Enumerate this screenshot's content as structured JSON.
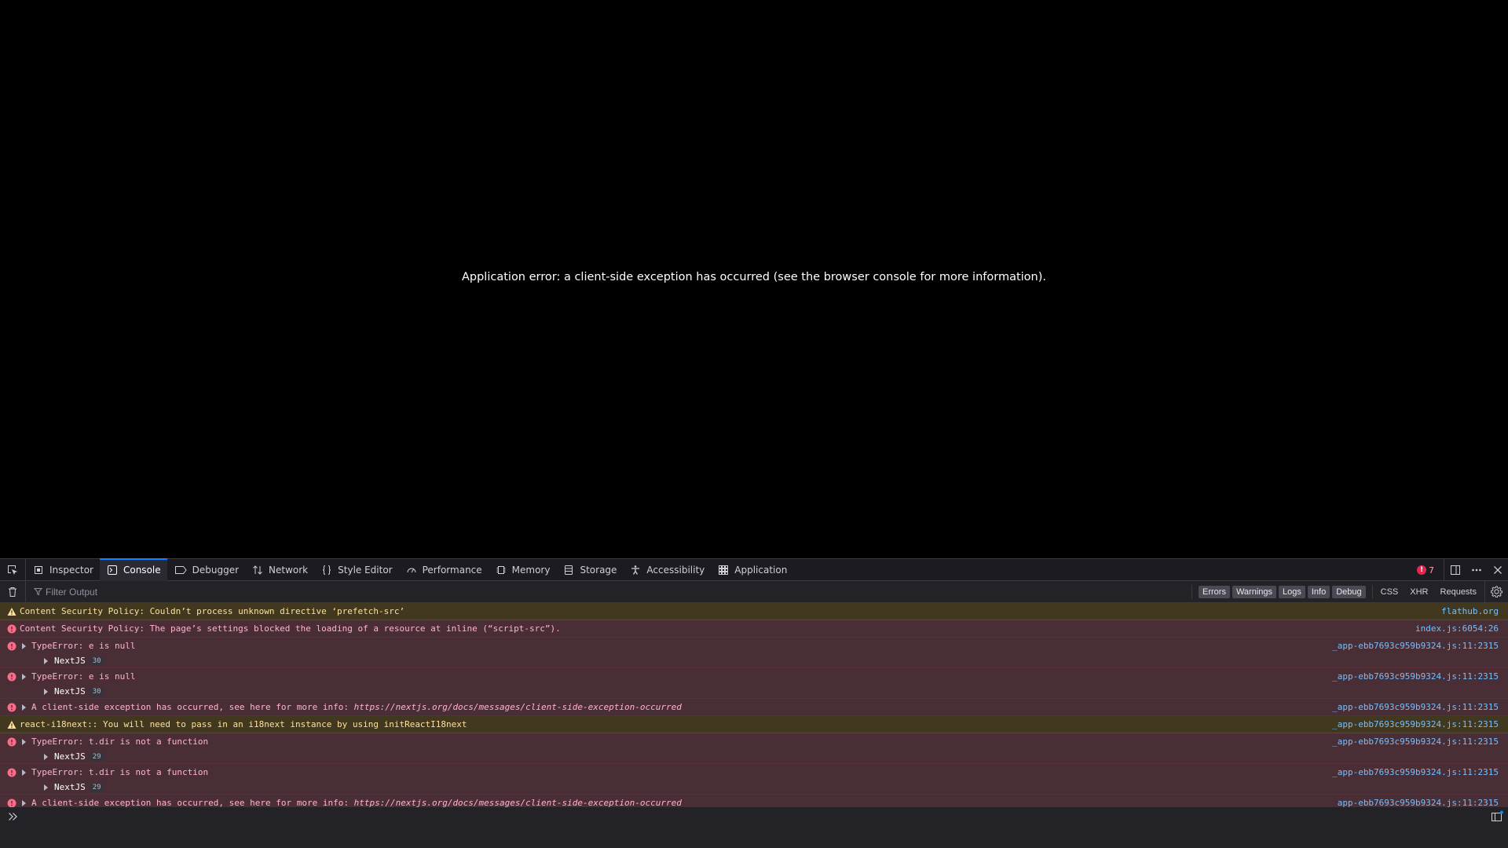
{
  "page": {
    "error_message": "Application error: a client-side exception has occurred (see the browser console for more information)."
  },
  "toolbar": {
    "tabs": [
      {
        "label": "Inspector",
        "icon": "inspector-icon"
      },
      {
        "label": "Console",
        "icon": "console-icon",
        "active": true
      },
      {
        "label": "Debugger",
        "icon": "debugger-icon"
      },
      {
        "label": "Network",
        "icon": "network-icon"
      },
      {
        "label": "Style Editor",
        "icon": "style-editor-icon"
      },
      {
        "label": "Performance",
        "icon": "performance-icon"
      },
      {
        "label": "Memory",
        "icon": "memory-icon"
      },
      {
        "label": "Storage",
        "icon": "storage-icon"
      },
      {
        "label": "Accessibility",
        "icon": "accessibility-icon"
      },
      {
        "label": "Application",
        "icon": "application-icon"
      }
    ],
    "error_count": "7"
  },
  "filter": {
    "placeholder": "Filter Output",
    "levels": [
      "Errors",
      "Warnings",
      "Logs",
      "Info",
      "Debug"
    ],
    "extras": [
      "CSS",
      "XHR",
      "Requests"
    ]
  },
  "messages": [
    {
      "level": "warn",
      "text": "Content Security Policy: Couldn’t process unknown directive ‘prefetch-src’",
      "source": "flathub.org"
    },
    {
      "level": "error",
      "text": "Content Security Policy: The page’s settings blocked the loading of a resource at inline (“script-src”).",
      "source": "index.js:6054:26"
    },
    {
      "level": "error",
      "text": "TypeError: e is null",
      "source": "_app-ebb7693c959b9324.js:11:2315",
      "stack_label": "NextJS",
      "stack_count": "30"
    },
    {
      "level": "error",
      "text": "TypeError: e is null",
      "source": "_app-ebb7693c959b9324.js:11:2315",
      "stack_label": "NextJS",
      "stack_count": "30"
    },
    {
      "level": "error",
      "text": "A client-side exception has occurred, see here for more info: ",
      "url": "https://nextjs.org/docs/messages/client-side-exception-occurred",
      "source": "_app-ebb7693c959b9324.js:11:2315"
    },
    {
      "level": "warn",
      "text": "react-i18next:: You will need to pass in an i18next instance by using initReactI18next",
      "source": "_app-ebb7693c959b9324.js:11:2315"
    },
    {
      "level": "error",
      "text": "TypeError: t.dir is not a function",
      "source": "_app-ebb7693c959b9324.js:11:2315",
      "stack_label": "NextJS",
      "stack_count": "29"
    },
    {
      "level": "error",
      "text": "TypeError: t.dir is not a function",
      "source": "_app-ebb7693c959b9324.js:11:2315",
      "stack_label": "NextJS",
      "stack_count": "29"
    },
    {
      "level": "error",
      "text": "A client-side exception has occurred, see here for more info: ",
      "url": "https://nextjs.org/docs/messages/client-side-exception-occurred",
      "source": "_app-ebb7693c959b9324.js:11:2315"
    }
  ],
  "colors": {
    "accent": "#0a84ff",
    "error_bg": "#4a2e36",
    "warn_bg": "#42381f",
    "link": "#75bfff"
  }
}
